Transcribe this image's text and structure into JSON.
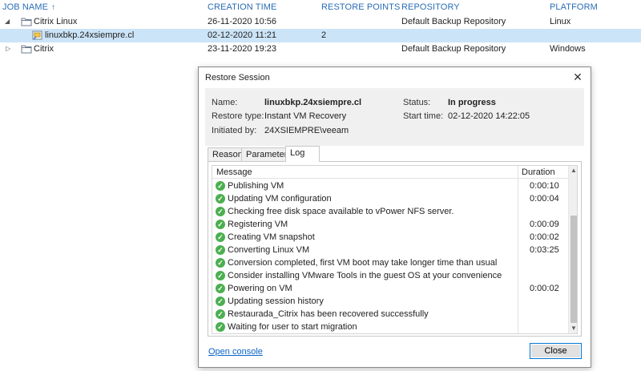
{
  "jobs_table": {
    "headers": {
      "job_name": "JOB NAME",
      "creation_time": "CREATION TIME",
      "restore_points": "RESTORE POINTS",
      "repository": "REPOSITORY",
      "platform": "PLATFORM"
    },
    "rows": [
      {
        "name": "Citrix Linux",
        "creation_time": "26-11-2020 10:56",
        "restore_points": "",
        "repository": "Default Backup Repository",
        "platform": "Linux",
        "icon": "folder-icon",
        "expanded": true
      },
      {
        "name": "linuxbkp.24xsiempre.cl",
        "creation_time": "02-12-2020 11:21",
        "restore_points": "2",
        "repository": "",
        "platform": "",
        "icon": "job-icon",
        "selected": true
      },
      {
        "name": "Citrix",
        "creation_time": "23-11-2020 19:23",
        "restore_points": "",
        "repository": "Default Backup Repository",
        "platform": "Windows",
        "icon": "folder-icon",
        "expanded": false
      }
    ]
  },
  "dialog": {
    "title": "Restore Session",
    "info": {
      "name_label": "Name:",
      "name_value": "linuxbkp.24xsiempre.cl",
      "restore_type_label": "Restore type:",
      "restore_type_value": "Instant VM Recovery",
      "initiated_by_label": "Initiated by:",
      "initiated_by_value": "24XSIEMPRE\\veeam",
      "status_label": "Status:",
      "status_value": "In progress",
      "start_time_label": "Start time:",
      "start_time_value": "02-12-2020 14:22:05"
    },
    "tabs": [
      {
        "label": "Reason",
        "active": false
      },
      {
        "label": "Parameters",
        "active": false
      },
      {
        "label": "Log",
        "active": true
      }
    ],
    "log": {
      "message_header": "Message",
      "duration_header": "Duration",
      "rows": [
        {
          "message": "Publishing VM",
          "duration": "0:00:10"
        },
        {
          "message": "Updating VM configuration",
          "duration": "0:00:04"
        },
        {
          "message": "Checking free disk space available to vPower NFS server.",
          "duration": ""
        },
        {
          "message": "Registering VM",
          "duration": "0:00:09"
        },
        {
          "message": "Creating VM snapshot",
          "duration": "0:00:02"
        },
        {
          "message": "Converting Linux VM",
          "duration": "0:03:25"
        },
        {
          "message": "Conversion completed, first VM boot may take longer time than usual",
          "duration": ""
        },
        {
          "message": "Consider installing VMware Tools in the guest OS at your convenience",
          "duration": ""
        },
        {
          "message": "Powering on VM",
          "duration": "0:00:02"
        },
        {
          "message": "Updating session history",
          "duration": ""
        },
        {
          "message": "Restaurada_Citrix has been recovered successfully",
          "duration": ""
        },
        {
          "message": "Waiting for user to start migration",
          "duration": ""
        }
      ]
    },
    "open_console_label": "Open console",
    "close_label": "Close"
  }
}
